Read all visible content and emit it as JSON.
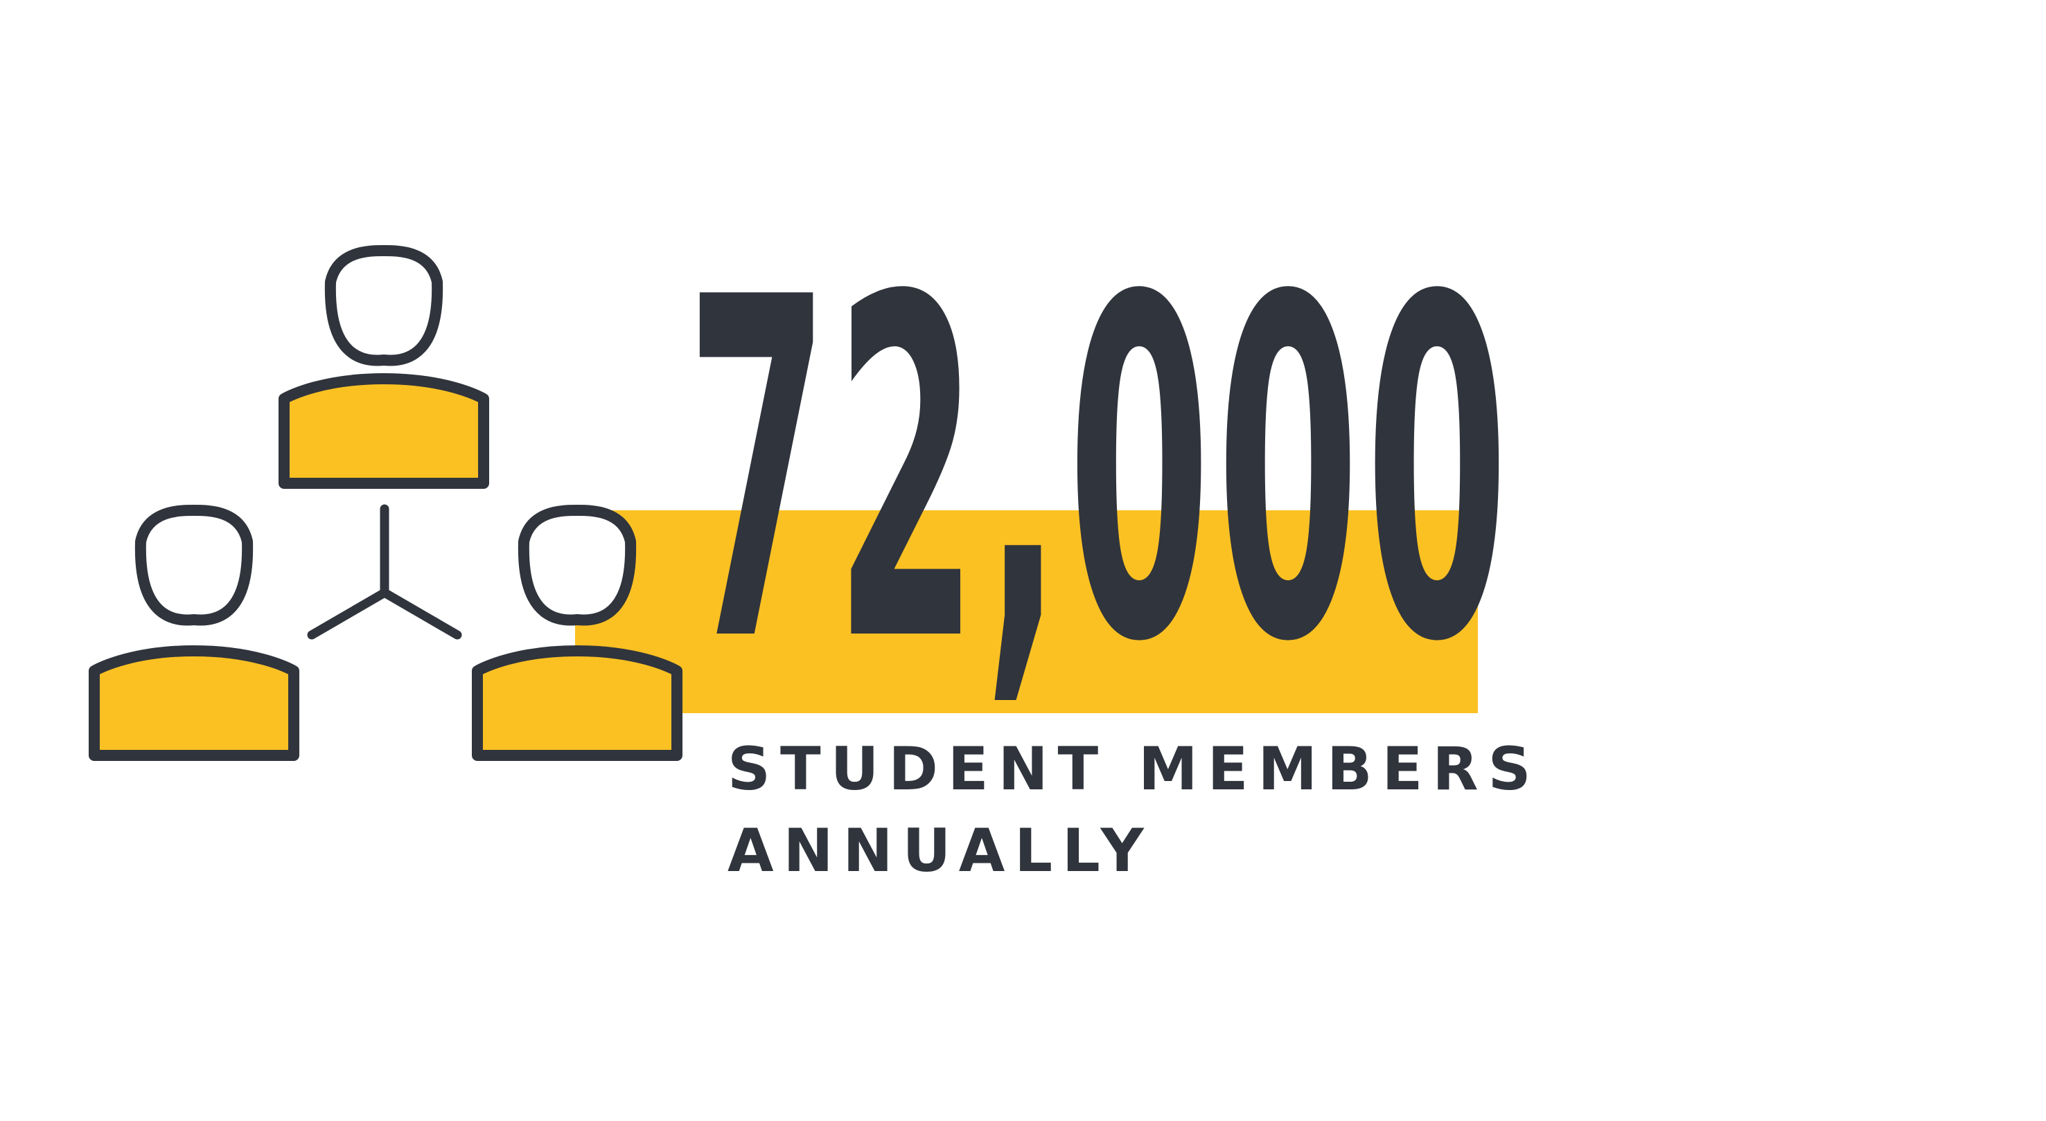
{
  "stat": {
    "value": "72,000",
    "caption_line_1": "STUDENT MEMBERS",
    "caption_line_2": "ANNUALLY"
  },
  "icons": {
    "main": "three-people-network-icon",
    "person": "person-icon",
    "connector": "network-connector-icon"
  },
  "colors": {
    "background": "#ffffff",
    "text": "#30343c",
    "accent": "#fbc123"
  }
}
